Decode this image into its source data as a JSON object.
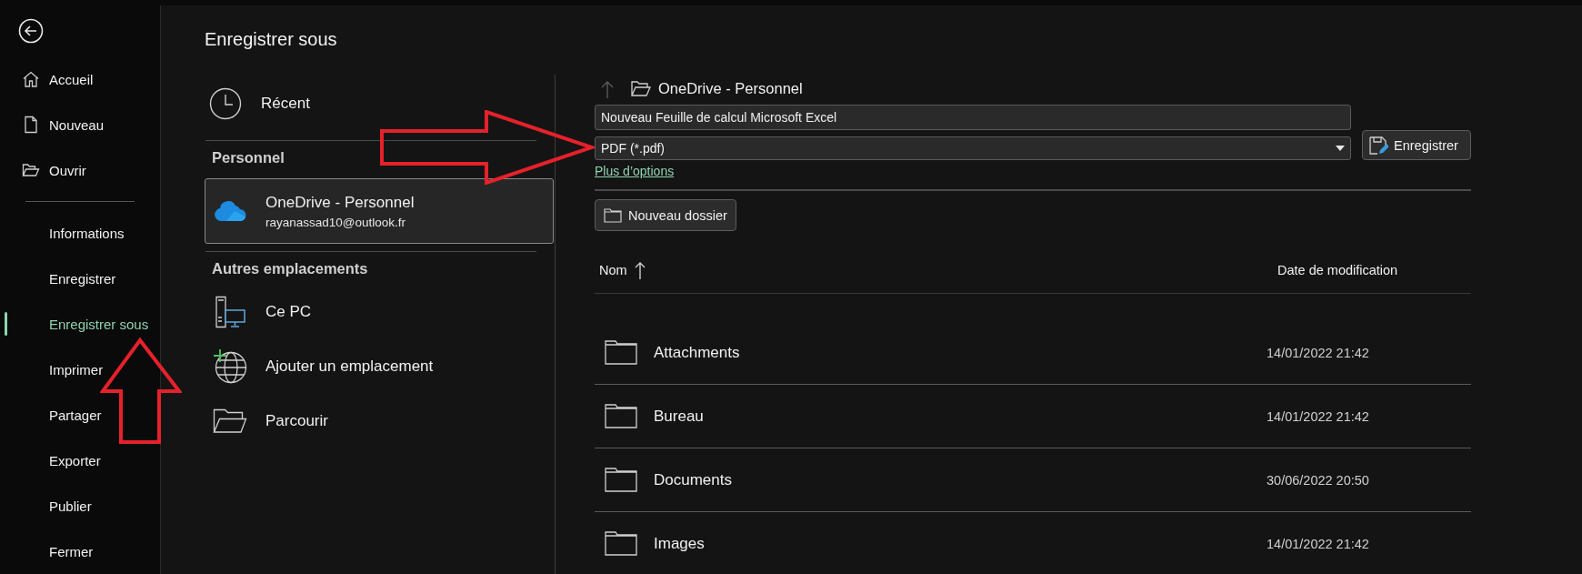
{
  "sidebar": {
    "top_items": [
      {
        "kind": "home",
        "label": "Accueil",
        "selected": false
      },
      {
        "kind": "new",
        "label": "Nouveau",
        "selected": false
      },
      {
        "kind": "open",
        "label": "Ouvrir",
        "selected": false
      }
    ],
    "items": [
      {
        "label": "Informations",
        "selected": false
      },
      {
        "label": "Enregistrer",
        "selected": false
      },
      {
        "label": "Enregistrer sous",
        "selected": true
      },
      {
        "label": "Imprimer",
        "selected": false
      },
      {
        "label": "Partager",
        "selected": false
      },
      {
        "label": "Exporter",
        "selected": false
      },
      {
        "label": "Publier",
        "selected": false
      },
      {
        "label": "Fermer",
        "selected": false
      }
    ]
  },
  "page_title": "Enregistrer sous",
  "locations": {
    "recent": {
      "label": "Récent",
      "selected": false
    },
    "sections": [
      {
        "heading": "Personnel",
        "items": [
          {
            "kind": "onedrive",
            "label": "OneDrive - Personnel",
            "sublabel": "rayanassad10@outlook.fr",
            "selected": true
          }
        ]
      },
      {
        "heading": "Autres emplacements",
        "items": [
          {
            "kind": "pc",
            "label": "Ce PC",
            "selected": false
          },
          {
            "kind": "add",
            "label": "Ajouter un emplacement",
            "selected": false
          },
          {
            "kind": "browse",
            "label": "Parcourir",
            "selected": false
          }
        ]
      }
    ]
  },
  "save_panel": {
    "breadcrumb": "OneDrive - Personnel",
    "filename": "Nouveau Feuille de calcul Microsoft Excel",
    "file_type": "PDF (*.pdf)",
    "save_button": "Enregistrer",
    "more_options_link": "Plus d’options",
    "new_folder_button": "Nouveau dossier"
  },
  "file_list": {
    "columns": [
      {
        "label": "Nom",
        "sorted": true
      },
      {
        "label": "Date de modification",
        "sorted": false
      }
    ],
    "rows": [
      {
        "name": "Attachments",
        "modified": "14/01/2022 21:42"
      },
      {
        "name": "Bureau",
        "modified": "14/01/2022 21:42"
      },
      {
        "name": "Documents",
        "modified": "30/06/2022 20:50"
      },
      {
        "name": "Images",
        "modified": "14/01/2022 21:42"
      }
    ]
  },
  "annotations": [
    {
      "kind": "right_arrow"
    },
    {
      "kind": "up_arrow"
    }
  ]
}
